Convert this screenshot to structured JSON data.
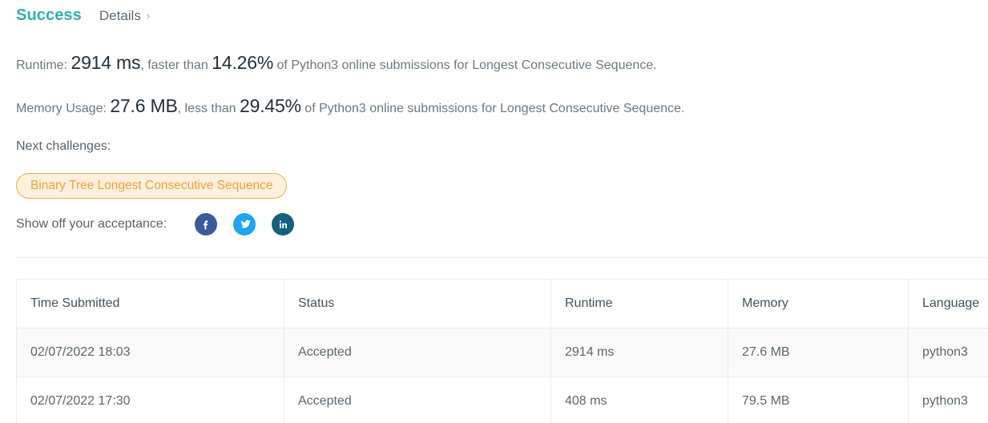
{
  "header": {
    "status": "Success",
    "details_label": "Details",
    "chevron": "›"
  },
  "results": {
    "runtime": {
      "label": "Runtime:",
      "value": "2914 ms",
      "comparator": ", faster than",
      "percentile": "14.26%",
      "tail": "of Python3 online submissions for Longest Consecutive Sequence."
    },
    "memory": {
      "label": "Memory Usage:",
      "value": "27.6 MB",
      "comparator": ", less than",
      "percentile": "29.45%",
      "tail": "of Python3 online submissions for Longest Consecutive Sequence."
    }
  },
  "next_challenges": {
    "label": "Next challenges:",
    "items": [
      {
        "title": "Binary Tree Longest Consecutive Sequence"
      }
    ]
  },
  "share": {
    "label": "Show off your acceptance:",
    "icons": [
      {
        "name": "facebook-icon",
        "color": "#3b5a9a"
      },
      {
        "name": "twitter-icon",
        "color": "#1da5ef"
      },
      {
        "name": "linkedin-icon",
        "color": "#15607f"
      }
    ]
  },
  "submissions": {
    "columns": [
      "Time Submitted",
      "Status",
      "Runtime",
      "Memory",
      "Language"
    ],
    "rows": [
      {
        "time": "02/07/2022 18:03",
        "status": "Accepted",
        "runtime": "2914 ms",
        "memory": "27.6 MB",
        "language": "python3"
      },
      {
        "time": "02/07/2022 17:30",
        "status": "Accepted",
        "runtime": "408 ms",
        "memory": "79.5 MB",
        "language": "python3"
      }
    ]
  },
  "colors": {
    "accent_teal": "#2eb3a6",
    "accepted_teal": "#29a397",
    "pill_border": "#f3ab4e",
    "pill_bg": "#fdf0dd",
    "pill_text": "#f0a13c"
  }
}
